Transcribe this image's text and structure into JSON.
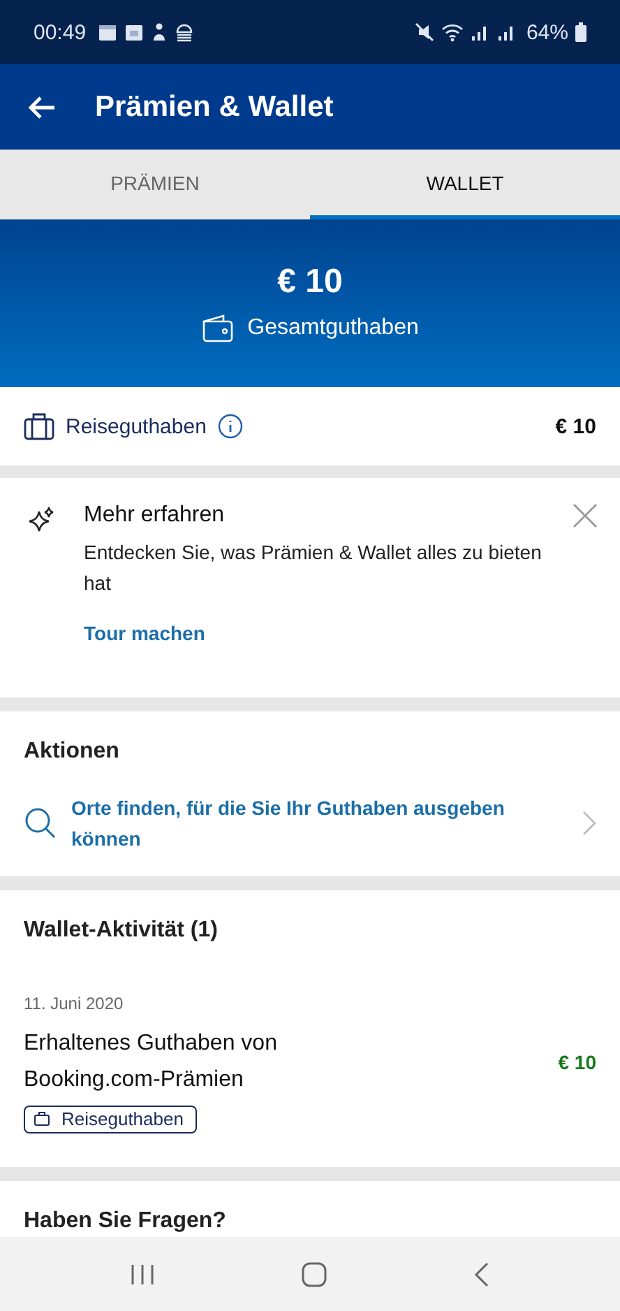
{
  "status_bar": {
    "time": "00:49",
    "battery": "64%"
  },
  "app_bar": {
    "title": "Prämien & Wallet"
  },
  "tabs": [
    {
      "label": "PRÄMIEN",
      "selected": false
    },
    {
      "label": "WALLET",
      "selected": true
    }
  ],
  "balance": {
    "amount": "€ 10",
    "label": "Gesamtguthaben"
  },
  "travel_credit": {
    "label": "Reiseguthaben",
    "amount": "€ 10"
  },
  "tour_card": {
    "title": "Mehr erfahren",
    "text": "Entdecken Sie, was Prämien & Wallet alles zu bieten hat",
    "link": "Tour machen"
  },
  "actions": {
    "heading": "Aktionen",
    "items": [
      {
        "label": "Orte finden, für die Sie Ihr Guthaben ausgeben können"
      }
    ]
  },
  "activity": {
    "heading": "Wallet-Aktivität (1)",
    "entries": [
      {
        "date": "11. Juni 2020",
        "description": "Erhaltenes Guthaben von Booking.com-Prämien",
        "amount": "€ 10",
        "tag": "Reiseguthaben"
      }
    ]
  },
  "questions": {
    "heading": "Haben Sie Fragen?"
  }
}
